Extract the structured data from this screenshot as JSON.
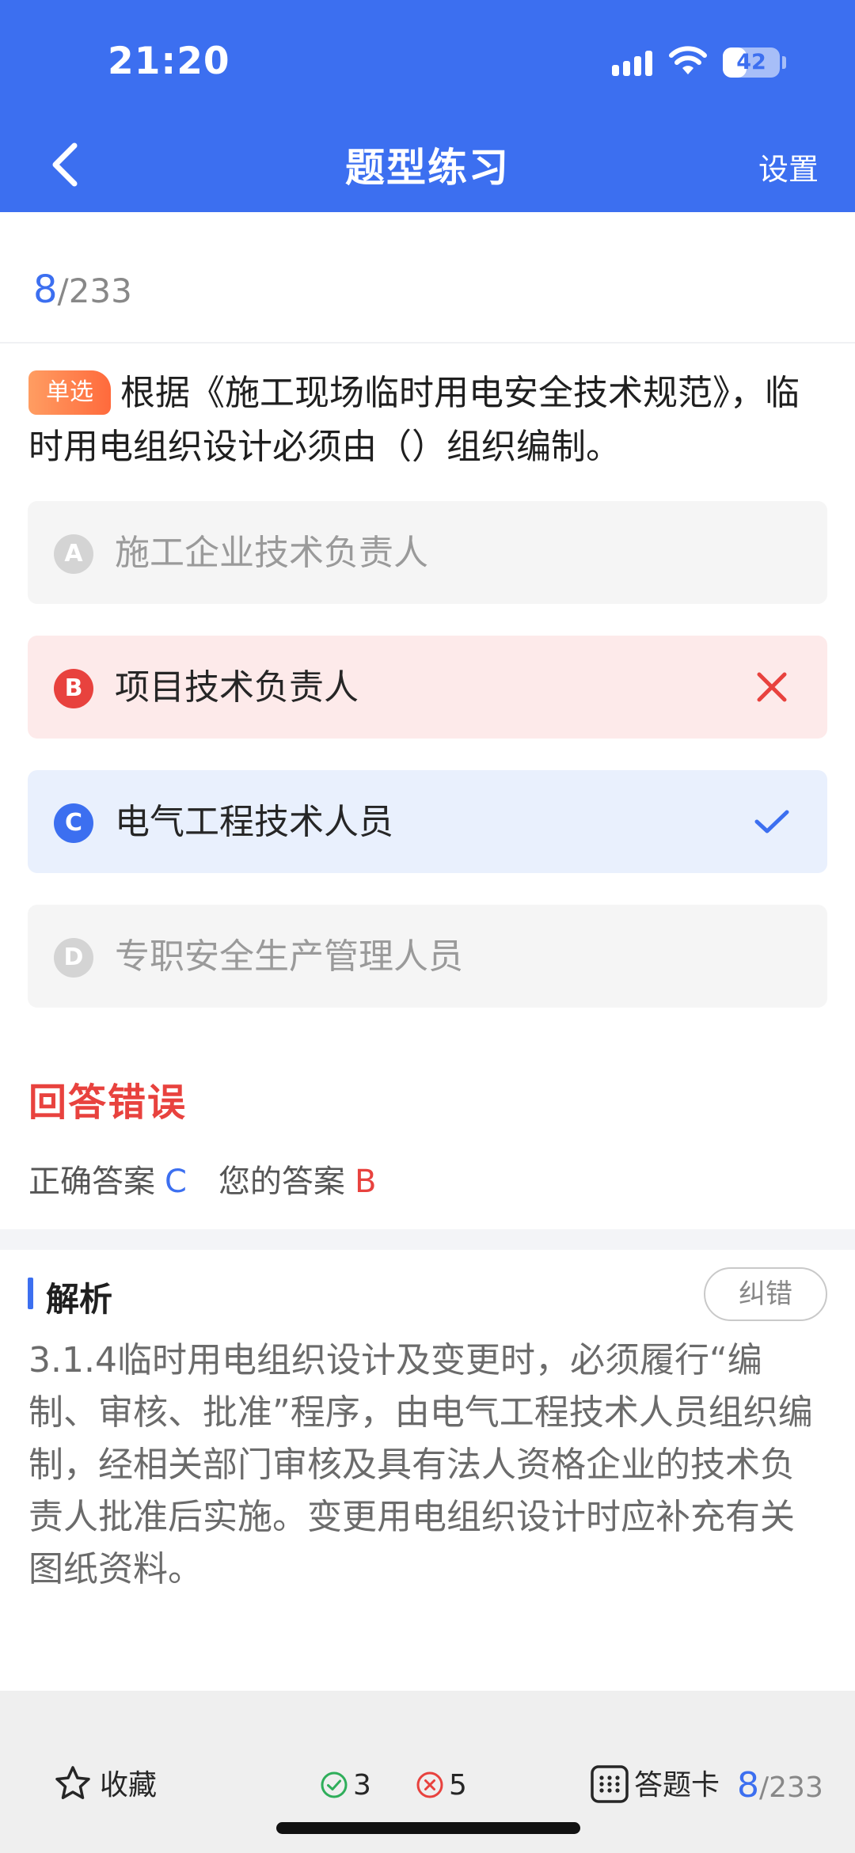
{
  "status_bar": {
    "time": "21:20",
    "battery_level": "42",
    "battery_fraction": 0.42
  },
  "nav": {
    "title": "题型练习",
    "settings": "设置"
  },
  "progress": {
    "current": "8",
    "total": "/233"
  },
  "question": {
    "type_badge": "单选",
    "text": "根据《施工现场临时用电安全技术规范》，临时用电组织设计必须由（）组织编制。"
  },
  "options": [
    {
      "letter": "A",
      "text": "施工企业技术负责人",
      "state": "normal"
    },
    {
      "letter": "B",
      "text": "项目技术负责人",
      "state": "wrong"
    },
    {
      "letter": "C",
      "text": "电气工程技术人员",
      "state": "right"
    },
    {
      "letter": "D",
      "text": "专职安全生产管理人员",
      "state": "normal"
    }
  ],
  "result": {
    "title": "回答错误",
    "correct_label": "正确答案",
    "correct_value": "C",
    "your_label": "您的答案",
    "your_value": "B"
  },
  "analysis": {
    "title": "解析",
    "report_button": "纠错",
    "text": "3.1.4临时用电组织设计及变更时，必须履行“编制、审核、批准”程序，由电气工程技术人员组织编制，经相关部门审核及具有法人资格企业的技术负责人批准后实施。变更用电组织设计时应补充有关图纸资料。"
  },
  "bottom_bar": {
    "favorite_label": "收藏",
    "correct_count": "3",
    "wrong_count": "5",
    "answer_card_label": "答题卡",
    "progress_current": "8",
    "progress_total": "/233"
  },
  "colors": {
    "primary": "#3c6ff0",
    "error": "#e8423e",
    "success": "#2fae5a"
  },
  "icons": [
    "back-icon",
    "signal-icon",
    "wifi-icon",
    "battery-icon",
    "close-icon",
    "check-icon",
    "star-icon",
    "check-circle-icon",
    "x-circle-icon",
    "grid-icon"
  ]
}
